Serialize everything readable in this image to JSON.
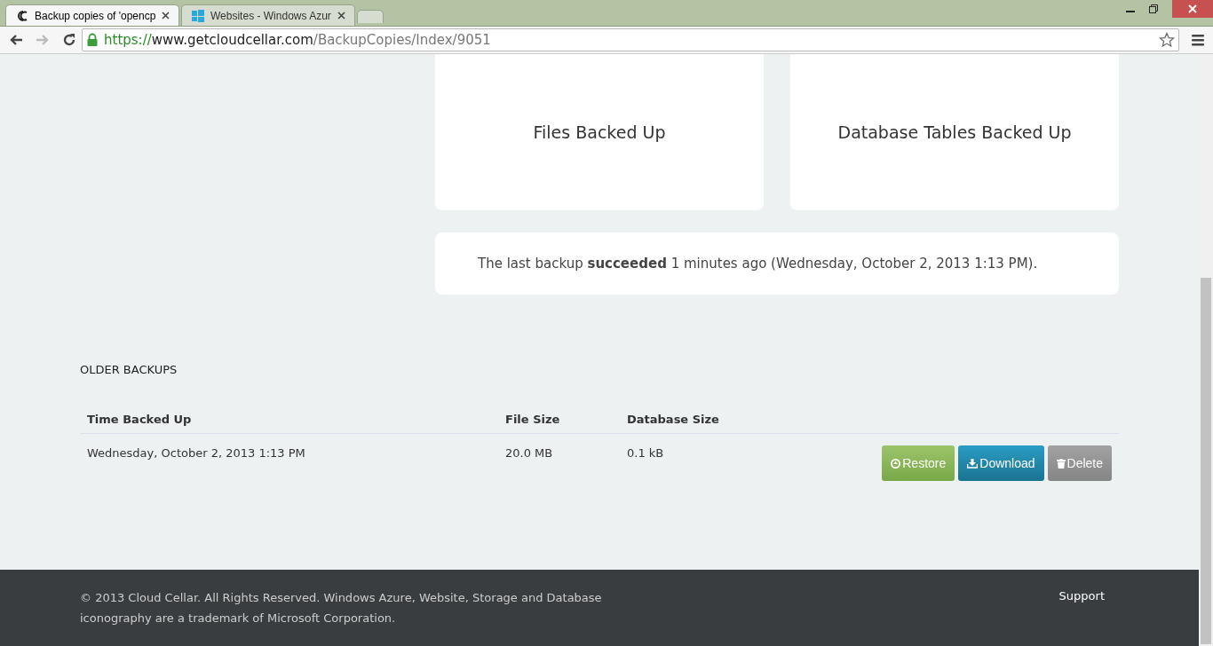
{
  "browser": {
    "tabs": [
      {
        "title": "Backup copies of 'opencp",
        "selected": true
      },
      {
        "title": "Websites - Windows Azur",
        "selected": false
      }
    ],
    "url": {
      "scheme": "https://",
      "host": "www.getcloudcellar.com",
      "path": "/BackupCopies/Index/9051"
    }
  },
  "cards": [
    {
      "label": "Files Backed Up"
    },
    {
      "label": "Database Tables Backed Up"
    }
  ],
  "status_message": "The last backup **succeeded** 1 minutes ago (Wednesday, October 2, 2013 1:13 PM).",
  "older_backups": {
    "heading": "OLDER BACKUPS",
    "columns": [
      "Time Backed Up",
      "File Size",
      "Database Size"
    ],
    "rows": [
      {
        "cells": [
          "Wednesday, October 2, 2013 1:13 PM",
          "20.0 MB",
          "0.1 kB"
        ],
        "actions": [
          {
            "kind": "restore",
            "label": "Restore"
          },
          {
            "kind": "download",
            "label": "Download"
          },
          {
            "kind": "delete",
            "label": "Delete"
          }
        ]
      }
    ]
  },
  "footer": {
    "copyright": "© 2013 Cloud Cellar. All Rights Reserved. Windows Azure, Website, Storage and Database iconography are a trademark of Microsoft Corporation.",
    "link": "Support"
  }
}
